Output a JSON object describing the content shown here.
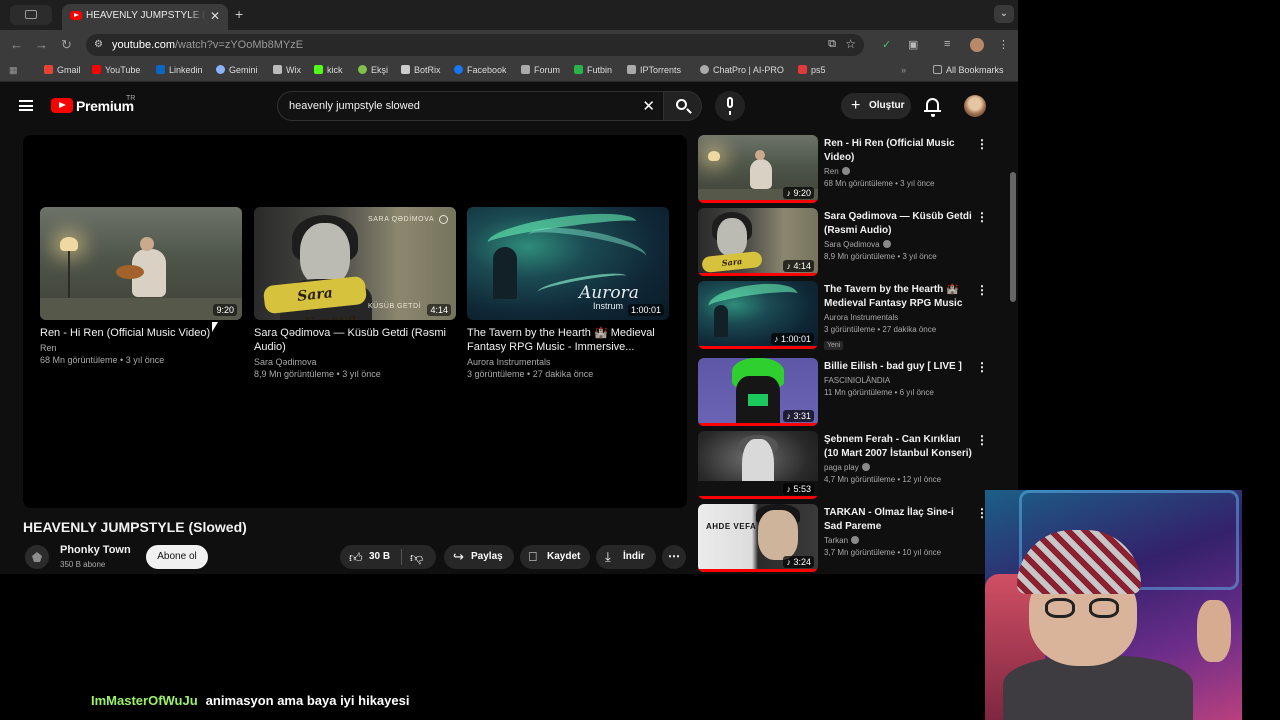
{
  "browser": {
    "tab_title": "HEAVENLY JUMPSTYLE (Slov",
    "url_host": "youtube.com",
    "url_path": "/watch?v=zYOoMb8MYzE",
    "bookmarks": [
      {
        "label": "Gmail",
        "color": "#ea4335"
      },
      {
        "label": "YouTube",
        "color": "#ff0000"
      },
      {
        "label": "Linkedin",
        "color": "#0a66c2"
      },
      {
        "label": "Gemini",
        "color": "#8ab4f8"
      },
      {
        "label": "Wix",
        "color": "#bbbbbb"
      },
      {
        "label": "kick",
        "color": "#53fc18"
      },
      {
        "label": "Ekşi",
        "color": "#81c14b"
      },
      {
        "label": "BotRix",
        "color": "#cccccc"
      },
      {
        "label": "Facebook",
        "color": "#1877f2"
      },
      {
        "label": "Forum",
        "color": "#aaaaaa"
      },
      {
        "label": "Futbin",
        "color": "#29b34a"
      },
      {
        "label": "IPTorrents",
        "color": "#aaaaaa"
      },
      {
        "label": "ChatPro | AI-PRO",
        "color": "#aaaaaa"
      },
      {
        "label": "ps5",
        "color": "#e03a3a"
      }
    ],
    "all_bookmarks": "All Bookmarks"
  },
  "youtube": {
    "brand": "Premium",
    "region": "TR",
    "search_query": "heavenly jumpstyle slowed",
    "create_label": "Oluştur"
  },
  "end_screen": [
    {
      "title": "Ren - Hi Ren (Official Music Video)",
      "channel": "Ren",
      "meta": "68 Mn görüntüleme • 3 yıl önce",
      "duration": "9:20"
    },
    {
      "title": "Sara Qədimova — Küsüb Getdi (Rəsmi Audio)",
      "channel": "Sara Qədimova",
      "meta": "8,9 Mn görüntüleme • 3 yıl önce",
      "duration": "4:14",
      "thumb_logo": "Sara Qədimova",
      "thumb_side": "SARA QƏDİMOVA",
      "thumb_side2": "KÜSÜB GETDİ"
    },
    {
      "title": "The Tavern by the Hearth 🏰 Medieval Fantasy RPG Music - Immersive...",
      "channel": "Aurora Instrumentals",
      "meta": "3 görüntüleme • 27 dakika önce",
      "duration": "1:00:01",
      "thumb_logo": "Aurora",
      "thumb_logo2": "Instrum"
    }
  ],
  "video": {
    "title": "HEAVENLY JUMPSTYLE (Slowed)",
    "channel": "Phonky Town",
    "subscribers": "350 B abone",
    "subscribe_label": "Abone ol",
    "likes": "30 B",
    "share_label": "Paylaş",
    "save_label": "Kaydet",
    "download_label": "İndir"
  },
  "recommendations": [
    {
      "title": "Ren - Hi Ren (Official Music Video)",
      "channel": "Ren",
      "verified": true,
      "meta": "68 Mn görüntüleme • 3 yıl önce",
      "duration": "9:20",
      "badge": ""
    },
    {
      "title": "Sara Qədimova — Küsüb Getdi (Rəsmi Audio)",
      "channel": "Sara Qədimova",
      "verified": true,
      "meta": "8,9 Mn görüntüleme • 3 yıl önce",
      "duration": "4:14",
      "badge": ""
    },
    {
      "title": "The Tavern by the Hearth 🏰 Medieval Fantasy RPG Music -...",
      "channel": "Aurora Instrumentals",
      "verified": false,
      "meta": "3 görüntüleme • 27 dakika önce",
      "duration": "1:00:01",
      "badge": "Yeni"
    },
    {
      "title": "Billie Eilish - bad guy [ LIVE ]",
      "channel": "FASCINIOLÂNDIA",
      "verified": false,
      "meta": "11 Mn görüntüleme • 6 yıl önce",
      "duration": "3:31",
      "badge": ""
    },
    {
      "title": "Şebnem Ferah - Can Kırıkları (10 Mart 2007 İstanbul Konseri)",
      "channel": "paga play",
      "verified": true,
      "meta": "4,7 Mn görüntüleme • 12 yıl önce",
      "duration": "5:53",
      "badge": ""
    },
    {
      "title": "TARKAN - Olmaz İlaç Sine-i Sad Pareme",
      "channel": "Tarkan",
      "verified": true,
      "meta": "3,7 Mn görüntüleme • 10 yıl önce",
      "duration": "3:24",
      "badge": "",
      "thumb_text": "AHDE VEFA"
    }
  ],
  "chat": {
    "username": "ImMasterOfWuJu",
    "message": "animasyon ama baya iyi hikayesi",
    "username_color": "#9cf16a"
  }
}
